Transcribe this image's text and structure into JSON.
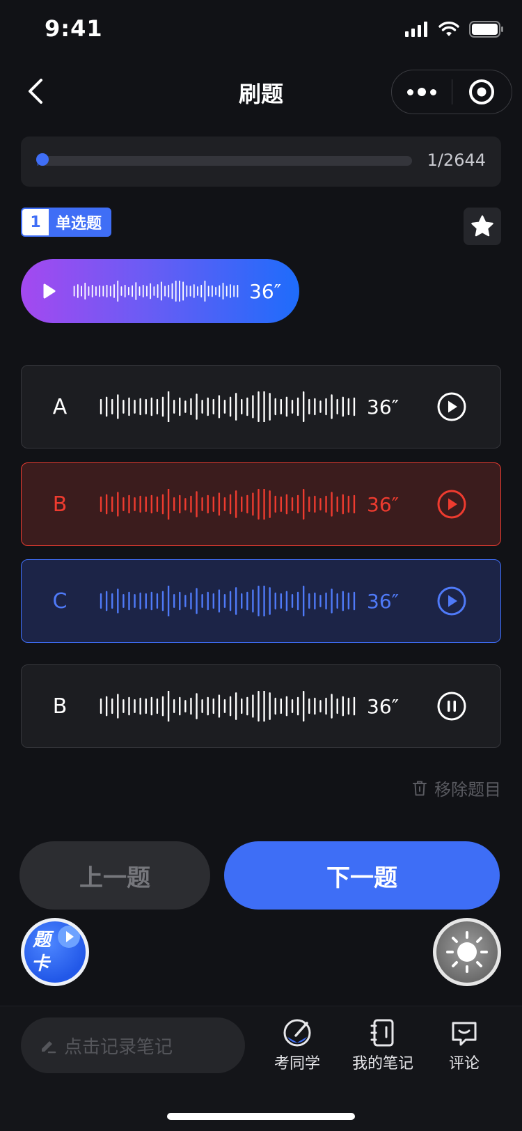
{
  "status_bar": {
    "time": "9:41"
  },
  "nav": {
    "title": "刷题",
    "menu_icon": "more-dots-icon",
    "close_icon": "target-circle-icon"
  },
  "progress": {
    "label": "1/2644",
    "fraction": 0.0004
  },
  "question": {
    "number": "1",
    "type": "单选题",
    "audio_duration": "36″"
  },
  "options": [
    {
      "letter": "A",
      "duration": "36″",
      "state": "normal",
      "control": "play"
    },
    {
      "letter": "B",
      "duration": "36″",
      "state": "wrong",
      "control": "play"
    },
    {
      "letter": "C",
      "duration": "36″",
      "state": "correct",
      "control": "play"
    },
    {
      "letter": "B",
      "duration": "36″",
      "state": "normal",
      "control": "pause"
    }
  ],
  "remove_question": "移除题目",
  "buttons": {
    "prev": "上一题",
    "next": "下一题"
  },
  "card_bubble": {
    "line1": "题",
    "line2": "卡"
  },
  "tabbar": {
    "note_placeholder": "点击记录笔记",
    "items": [
      {
        "label": "考同学",
        "icon": "pen-circle-icon"
      },
      {
        "label": "我的笔记",
        "icon": "notebook-icon"
      },
      {
        "label": "评论",
        "icon": "comment-icon"
      }
    ]
  },
  "colors": {
    "accent": "#3f6ef6",
    "wrong": "#e53b30",
    "bg": "#111216"
  }
}
